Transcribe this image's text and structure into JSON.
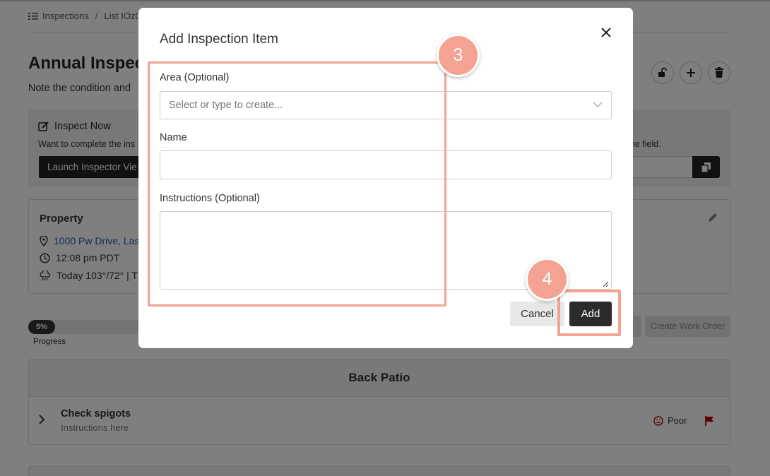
{
  "breadcrumb": {
    "root": "Inspections",
    "separator": "/",
    "current": "List IOz0"
  },
  "page": {
    "title": "Annual Inspec",
    "subtitle": "Note the condition and"
  },
  "inspect_now": {
    "title": "Inspect Now",
    "description": "Want to complete the ins",
    "description_right": "n the field.",
    "launch_label": "Launch Inspector Vie"
  },
  "property": {
    "title": "Property",
    "address": "1000 Pw Drive, Las",
    "time": "12:08 pm PDT",
    "weather": "Today 103°/72° | T"
  },
  "progress": {
    "percent": 5,
    "percent_label": "5%",
    "label": "Progress"
  },
  "actions": {
    "create_work_order": "Create Work Order"
  },
  "area": {
    "name": "Back Patio",
    "items": [
      {
        "name": "Check spigots",
        "instructions": "Instructions here",
        "rating": "Poor"
      }
    ]
  },
  "modal": {
    "title": "Add Inspection Item",
    "area_label": "Area (Optional)",
    "area_placeholder": "Select or type to create...",
    "name_label": "Name",
    "name_value": "",
    "instructions_label": "Instructions (Optional)",
    "instructions_value": "",
    "cancel_label": "Cancel",
    "add_label": "Add"
  },
  "callouts": {
    "step_3": "3",
    "step_4": "4"
  },
  "colors": {
    "callout": "#f4a292",
    "primary_dark": "#2b2b2b",
    "link_blue": "#2a5bb5",
    "flag_red": "#b00000"
  }
}
